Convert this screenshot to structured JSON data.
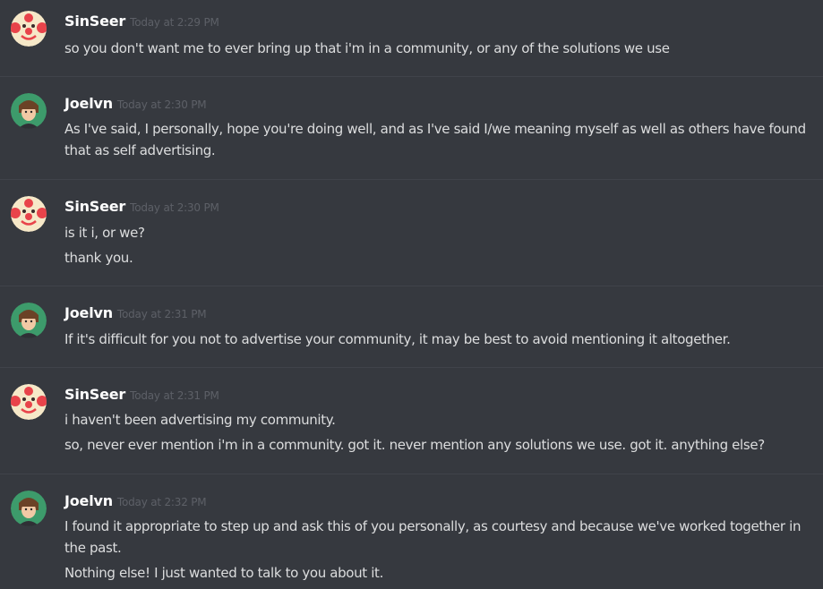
{
  "messages": [
    {
      "author": "SinSeer",
      "avatar": "clown-avatar",
      "timestamp": "Today at 2:29 PM",
      "lines": [
        "so you don't want me to ever bring up that i'm in a community, or any of the solutions we use"
      ]
    },
    {
      "author": "Joelvn",
      "avatar": "person-avatar",
      "timestamp": "Today at 2:30 PM",
      "lines": [
        "As I've said, I personally, hope you're doing well, and as I've said I/we meaning myself as well as others have found that as self advertising."
      ]
    },
    {
      "author": "SinSeer",
      "avatar": "clown-avatar",
      "timestamp": "Today at 2:30 PM",
      "lines": [
        "is it i, or we?",
        "thank you."
      ]
    },
    {
      "author": "Joelvn",
      "avatar": "person-avatar",
      "timestamp": "Today at 2:31 PM",
      "lines": [
        "If it's difficult for you not to advertise your community, it may be best to avoid mentioning it altogether."
      ]
    },
    {
      "author": "SinSeer",
      "avatar": "clown-avatar",
      "timestamp": "Today at 2:31 PM",
      "lines": [
        "i haven't been advertising my community.",
        "so, never ever mention i'm in a community. got it. never mention any solutions we use. got it. anything else?"
      ]
    },
    {
      "author": "Joelvn",
      "avatar": "person-avatar",
      "timestamp": "Today at 2:32 PM",
      "lines": [
        "I found it appropriate to step up and ask this of you personally, as courtesy and because we've worked together in the past.",
        "Nothing else! I just wanted to talk to you about it."
      ]
    }
  ],
  "colors": {
    "background": "#36393f",
    "username": "#ffffff",
    "timestamp": "#5d6067",
    "text": "#dcddde",
    "divider": "#40434a"
  }
}
